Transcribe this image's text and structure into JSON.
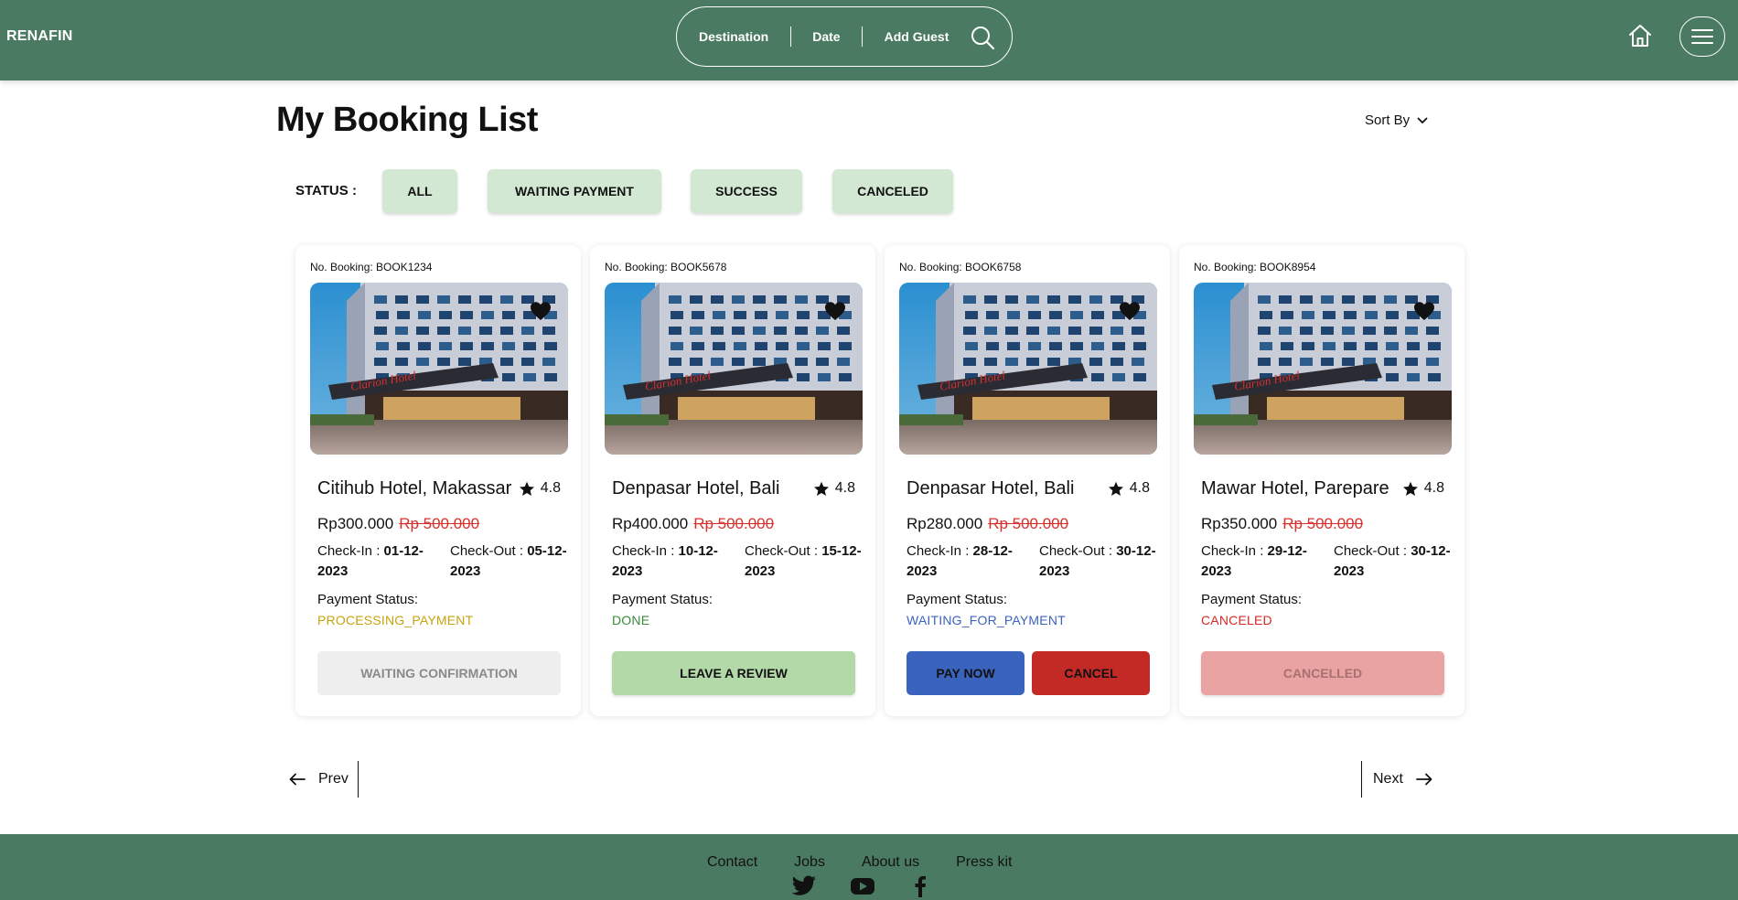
{
  "header": {
    "brand": "RENAFIN",
    "search": {
      "destination": "Destination",
      "date": "Date",
      "guest": "Add Guest"
    }
  },
  "page": {
    "title": "My Booking List",
    "sort_label": "Sort By",
    "status_label": "STATUS :",
    "filters": [
      "ALL",
      "WAITING PAYMENT",
      "SUCCESS",
      "CANCELED"
    ]
  },
  "labels": {
    "checkin": "Check-In : ",
    "checkout": "Check-Out : ",
    "payment_status": "Payment Status:"
  },
  "bookings": [
    {
      "booking_no": "No. Booking: BOOK1234",
      "name": "Citihub Hotel, Makassar",
      "rating": "4.8",
      "price": "Rp300.000",
      "old_price": "Rp 500.000",
      "checkin": "01-12-2023",
      "checkout": "05-12-2023",
      "status": "PROCESSING_PAYMENT",
      "status_color": "#c9a30c",
      "actions": [
        {
          "label": "WAITING CONFIRMATION",
          "bg": "#eeeeee",
          "color": "#8a8a8a"
        }
      ]
    },
    {
      "booking_no": "No. Booking: BOOK5678",
      "name": "Denpasar Hotel, Bali",
      "rating": "4.8",
      "price": "Rp400.000",
      "old_price": "Rp 500.000",
      "checkin": "10-12-2023",
      "checkout": "15-12-2023",
      "status": "DONE",
      "status_color": "#3a8a3a",
      "actions": [
        {
          "label": "LEAVE A REVIEW",
          "bg": "#b3d9a8",
          "color": "#111111"
        }
      ]
    },
    {
      "booking_no": "No. Booking: BOOK6758",
      "name": "Denpasar Hotel, Bali",
      "rating": "4.8",
      "price": "Rp280.000",
      "old_price": "Rp 500.000",
      "checkin": "28-12-2023",
      "checkout": "30-12-2023",
      "status": "WAITING_FOR_PAYMENT",
      "status_color": "#3b63c0",
      "actions": [
        {
          "label": "PAY NOW",
          "bg": "#3a63bd",
          "color": "#111111"
        },
        {
          "label": "CANCEL",
          "bg": "#c32a26",
          "color": "#111111"
        }
      ]
    },
    {
      "booking_no": "No. Booking: BOOK8954",
      "name": "Mawar Hotel, Parepare",
      "rating": "4.8",
      "price": "Rp350.000",
      "old_price": "Rp 500.000",
      "checkin": "29-12-2023",
      "checkout": "30-12-2023",
      "status": "CANCELED",
      "status_color": "#d32b26",
      "actions": [
        {
          "label": "CANCELLED",
          "bg": "#eaa3a3",
          "color": "#a87070"
        }
      ]
    }
  ],
  "pagination": {
    "prev": "Prev",
    "next": "Next"
  },
  "footer": {
    "links": [
      "Contact",
      "Jobs",
      "About us",
      "Press kit"
    ]
  },
  "colors": {
    "primary": "#4a7b62",
    "chip": "#d3e8d2",
    "strike": "#d9302c"
  }
}
